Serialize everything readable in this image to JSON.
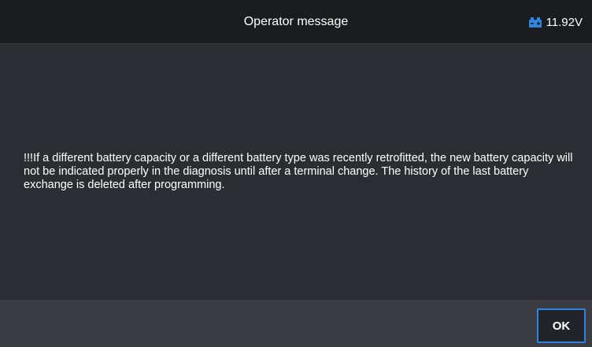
{
  "header": {
    "title": "Operator message",
    "battery_icon": "vehicle-battery-icon",
    "voltage": "11.92V"
  },
  "message": {
    "text": "!!!If a different battery capacity or a different battery type was recently retrofitted, the new battery capacity will not be indicated properly in the diagnosis until after a terminal change. The history of the last battery exchange is deleted after programming."
  },
  "footer": {
    "ok_label": "OK"
  },
  "colors": {
    "accent": "#2f84e0",
    "header_bg": "#1b1c20",
    "content_bg": "#2b2d32",
    "footer_bg": "#3a3c42"
  }
}
